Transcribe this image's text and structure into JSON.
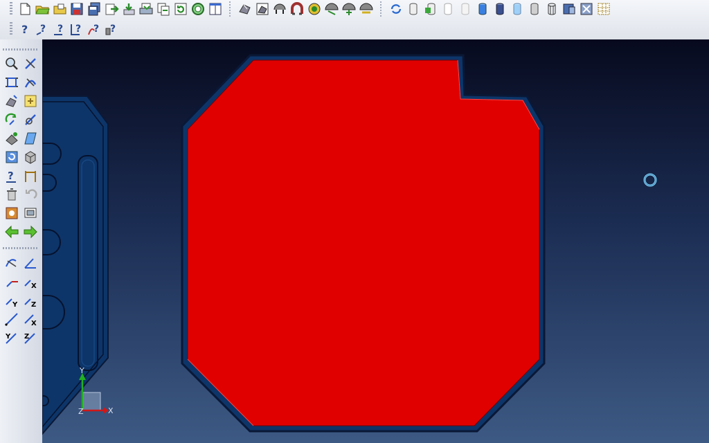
{
  "toolbar_top": {
    "row1_icons": [
      "new-document-icon",
      "open-folder-icon",
      "open-recent-icon",
      "save-icon",
      "save-as-icon",
      "import-icon",
      "export-icon",
      "print-icon",
      "copy-icon",
      "refresh-icon",
      "zoom-magnifier-icon",
      "window-icon",
      "shade-icon",
      "shade-edges-icon",
      "hidden-line-icon",
      "wireframe-icon",
      "render-icon",
      "perspective-icon",
      "walk-icon",
      "fly-icon",
      "regenerate-icon",
      "cylinder-icon",
      "cylinder-add-icon",
      "cylinder-outline-icon",
      "cylinder-faded-icon",
      "cylinder-blue-icon",
      "cylinder-dark-icon",
      "cylinder-light-icon",
      "cylinder-gray-icon",
      "cylinder-wire-icon",
      "cylinder-section-icon",
      "tools-icon",
      "grid-icon"
    ],
    "row2_icons": [
      "help-icon",
      "help-point-icon",
      "help-line-icon",
      "help-angle-icon",
      "help-curve-icon",
      "help-settings-icon"
    ]
  },
  "toolbar_left": {
    "icons": [
      "zoom-window-icon",
      "trim-icon",
      "fit-view-icon",
      "slice-icon",
      "move-icon",
      "layer-icon",
      "rotate-view-icon",
      "edit-sketch-icon",
      "paint-icon",
      "plane-icon",
      "refresh-view-icon",
      "box-icon",
      "query-icon",
      "measure-icon",
      "delete-icon",
      "undo-icon",
      "settings-icon",
      "display-icon",
      "back-arrow-icon",
      "forward-arrow-icon",
      "curve-icon",
      "angle-icon",
      "axis-xy-icon",
      "axis-x-icon",
      "axis-y-icon",
      "axis-z-icon",
      "vector-icon",
      "vector-x-icon",
      "vector-y-icon",
      "vector-z-icon"
    ]
  },
  "viewport": {
    "axis_labels": {
      "x": "X",
      "y": "Y",
      "z": "Z"
    },
    "colors": {
      "selected_face": "#e00000",
      "part_body": "#0d3569",
      "part_edge": "#0a1836",
      "background_top": "#070a1e",
      "background_bottom": "#3d5a84",
      "axis_x": "#d01818",
      "axis_y": "#22b022",
      "axis_z": "#9aa8c0"
    },
    "cursor_icon": "rotation-center-icon"
  }
}
